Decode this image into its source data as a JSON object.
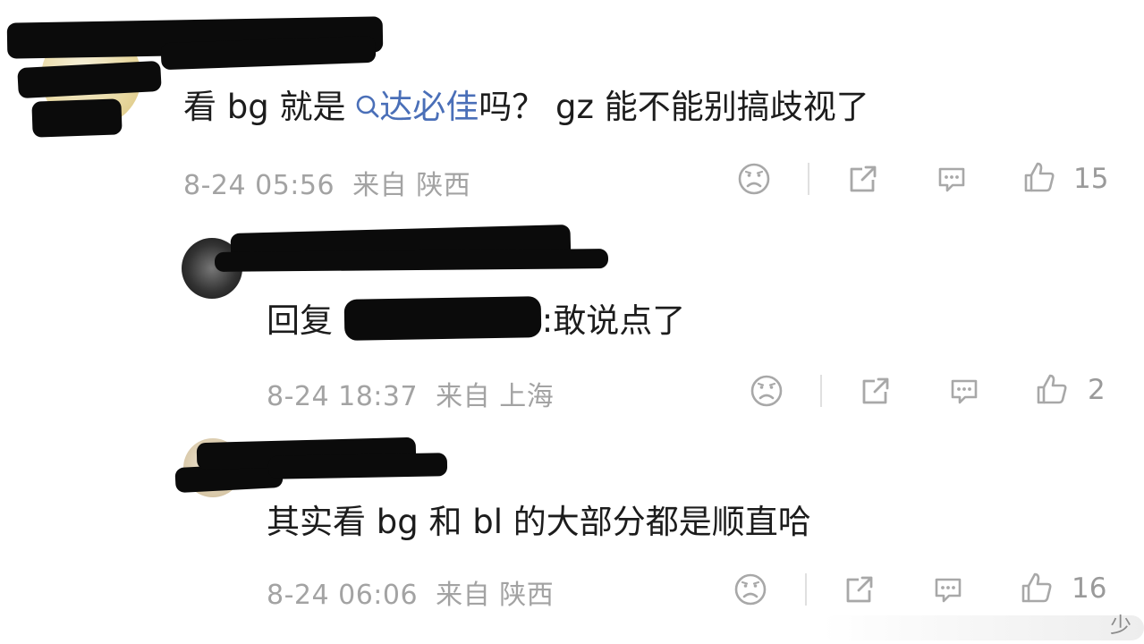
{
  "comments": [
    {
      "text_before": "看 bg 就是 ",
      "tag": "达必佳",
      "text_after": "吗？ gz 能不能别搞歧视了",
      "time": "8-24 05:56",
      "from": "来自",
      "location": "陕西",
      "likes": "15"
    },
    {
      "text_before": "回复 @",
      "text_after": ":敢说点了",
      "time": "8-24 18:37",
      "from": "来自",
      "location": "上海",
      "likes": "2"
    },
    {
      "text": "其实看 bg 和 bl 的大部分都是顺直哈",
      "time": "8-24 06:06",
      "from": "来自",
      "location": "陕西",
      "likes": "16"
    }
  ],
  "watermark": {
    "text": "少"
  },
  "icons": {
    "dislike": "sad-face-icon",
    "share": "share-icon",
    "comment": "comment-icon",
    "like": "thumbs-up-icon",
    "search": "search-icon"
  }
}
